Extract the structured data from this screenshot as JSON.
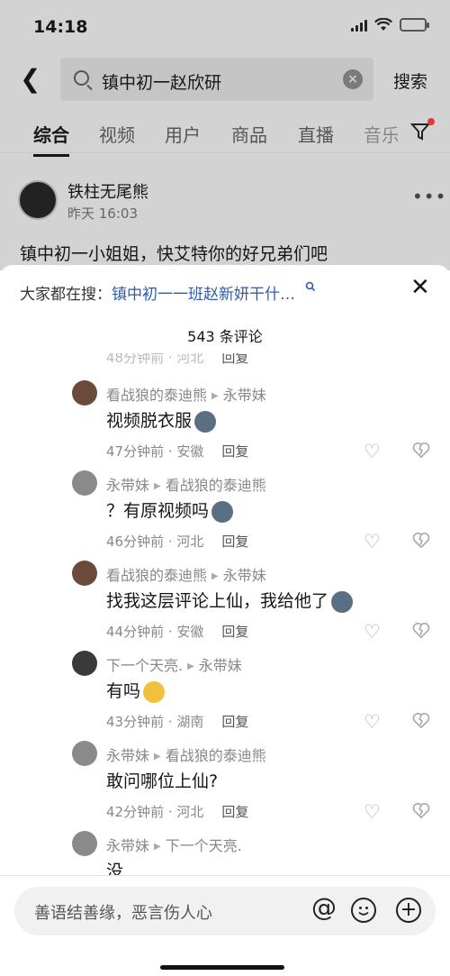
{
  "status": {
    "time": "14:18"
  },
  "search": {
    "query": "镇中初一赵欣研",
    "button": "搜索"
  },
  "tabs": [
    "综合",
    "视频",
    "用户",
    "商品",
    "直播",
    "音乐"
  ],
  "post": {
    "author": "铁柱无尾熊",
    "time": "昨天 16:03",
    "text": "镇中初一小姐姐，快艾特你的好兄弟们吧"
  },
  "sheet": {
    "hot_label": "大家都在搜：",
    "hot_link": "镇中初一一班赵新妍干什…",
    "count": "543 条评论",
    "reply_label": "回复"
  },
  "comments": [
    {
      "name": "看战狼的泰迪熊",
      "to": "永带妹",
      "text": "视频脱衣服",
      "emoji": "husky",
      "meta": "47分钟前 · 安徽"
    },
    {
      "name": "永带妹",
      "to": "看战狼的泰迪熊",
      "text": "？有原视频吗",
      "emoji": "husky",
      "meta": "46分钟前 · 河北"
    },
    {
      "name": "看战狼的泰迪熊",
      "to": "永带妹",
      "text": "找我这层评论上仙，我给他了",
      "emoji": "husky",
      "meta": "44分钟前 · 安徽"
    },
    {
      "name": "下一个天亮.",
      "to": "永带妹",
      "text": "有吗",
      "emoji": "grin",
      "meta": "43分钟前 · 湖南"
    },
    {
      "name": "永带妹",
      "to": "看战狼的泰迪熊",
      "text": "敢问哪位上仙?",
      "emoji": "",
      "meta": "42分钟前 · 河北"
    },
    {
      "name": "永带妹",
      "to": "下一个天亮.",
      "text": "没",
      "emoji": "",
      "meta": ""
    }
  ],
  "input": {
    "placeholder": "善语结善缘，恶言伤人心"
  },
  "colors": {
    "link": "#2a5db0",
    "badge": "#e53935",
    "battery": "#4cd964"
  }
}
